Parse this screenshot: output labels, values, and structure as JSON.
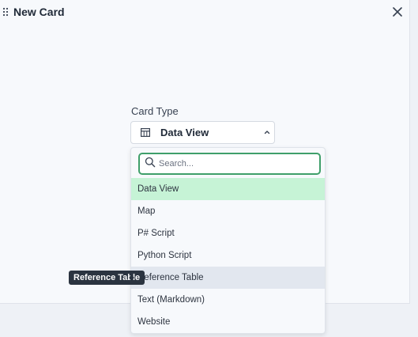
{
  "header": {
    "title": "New Card"
  },
  "form": {
    "card_type_label": "Card Type",
    "selected_value": "Data View",
    "search_placeholder": "Search...",
    "search_value": "",
    "options": [
      {
        "label": "Data View",
        "state": "selected"
      },
      {
        "label": "Map",
        "state": ""
      },
      {
        "label": "P# Script",
        "state": ""
      },
      {
        "label": "Python Script",
        "state": ""
      },
      {
        "label": "Reference Table",
        "state": "hover"
      },
      {
        "label": "Text (Markdown)",
        "state": ""
      },
      {
        "label": "Website",
        "state": ""
      }
    ]
  },
  "tooltip": {
    "text": "Reference Table"
  },
  "icons": {
    "drag": "drag-handle-icon",
    "close": "close-icon",
    "table": "table-icon",
    "chevron": "chevron-up-icon",
    "search": "search-icon"
  },
  "colors": {
    "selected_bg": "#c6f3d6",
    "hover_bg": "#e2e7ef",
    "search_border": "#3f9f6a",
    "tooltip_bg": "#2b3440"
  }
}
